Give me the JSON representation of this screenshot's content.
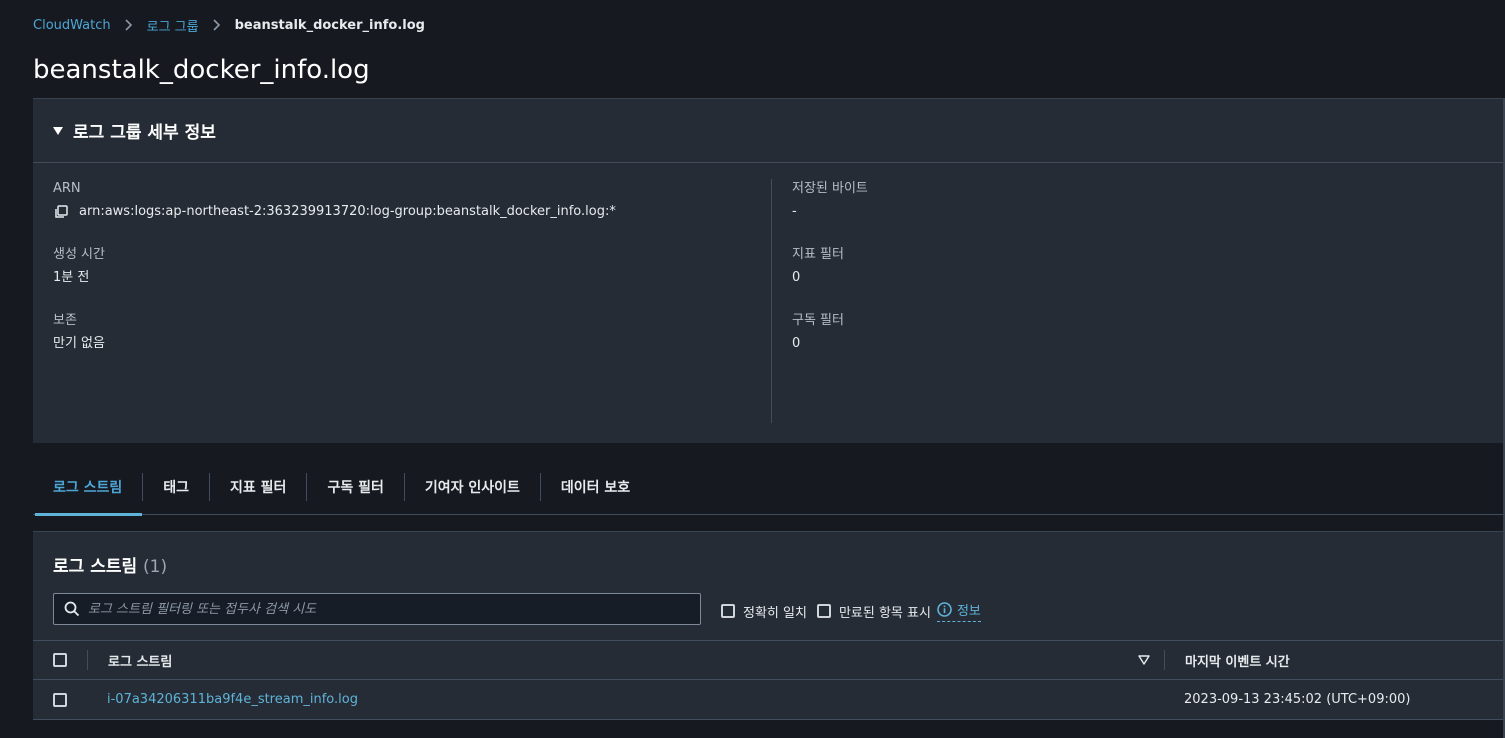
{
  "breadcrumb": {
    "root": "CloudWatch",
    "parent": "로그 그룹",
    "current": "beanstalk_docker_info.log"
  },
  "page_title": "beanstalk_docker_info.log",
  "details": {
    "title": "로그 그룹 세부 정보",
    "arn_label": "ARN",
    "arn_value": "arn:aws:logs:ap-northeast-2:363239913720:log-group:beanstalk_docker_info.log:*",
    "created_label": "생성 시간",
    "created_value": "1분 전",
    "retention_label": "보존",
    "retention_value": "만기 없음",
    "stored_bytes_label": "저장된 바이트",
    "stored_bytes_value": "-",
    "metric_filters_label": "지표 필터",
    "metric_filters_value": "0",
    "subscription_filters_label": "구독 필터",
    "subscription_filters_value": "0"
  },
  "tabs": [
    {
      "label": "로그 스트림",
      "active": true
    },
    {
      "label": "태그"
    },
    {
      "label": "지표 필터"
    },
    {
      "label": "구독 필터"
    },
    {
      "label": "기여자 인사이트"
    },
    {
      "label": "데이터 보호"
    }
  ],
  "streams": {
    "title": "로그 스트림",
    "count": "(1)",
    "search_placeholder": "로그 스트림 필터링 또는 접두사 검색 시도",
    "exact_match_label": "정확히 일치",
    "show_expired_label": "만료된 항목 표시",
    "info_label": "정보",
    "col_name": "로그 스트림",
    "col_last_event": "마지막 이벤트 시간",
    "rows": [
      {
        "name": "i-07a34206311ba9f4e_stream_info.log",
        "last_event": "2023-09-13 23:45:02 (UTC+09:00)"
      }
    ]
  },
  "colors": {
    "link": "#5fb3d9",
    "panel": "#252c35",
    "background": "#16191f"
  }
}
